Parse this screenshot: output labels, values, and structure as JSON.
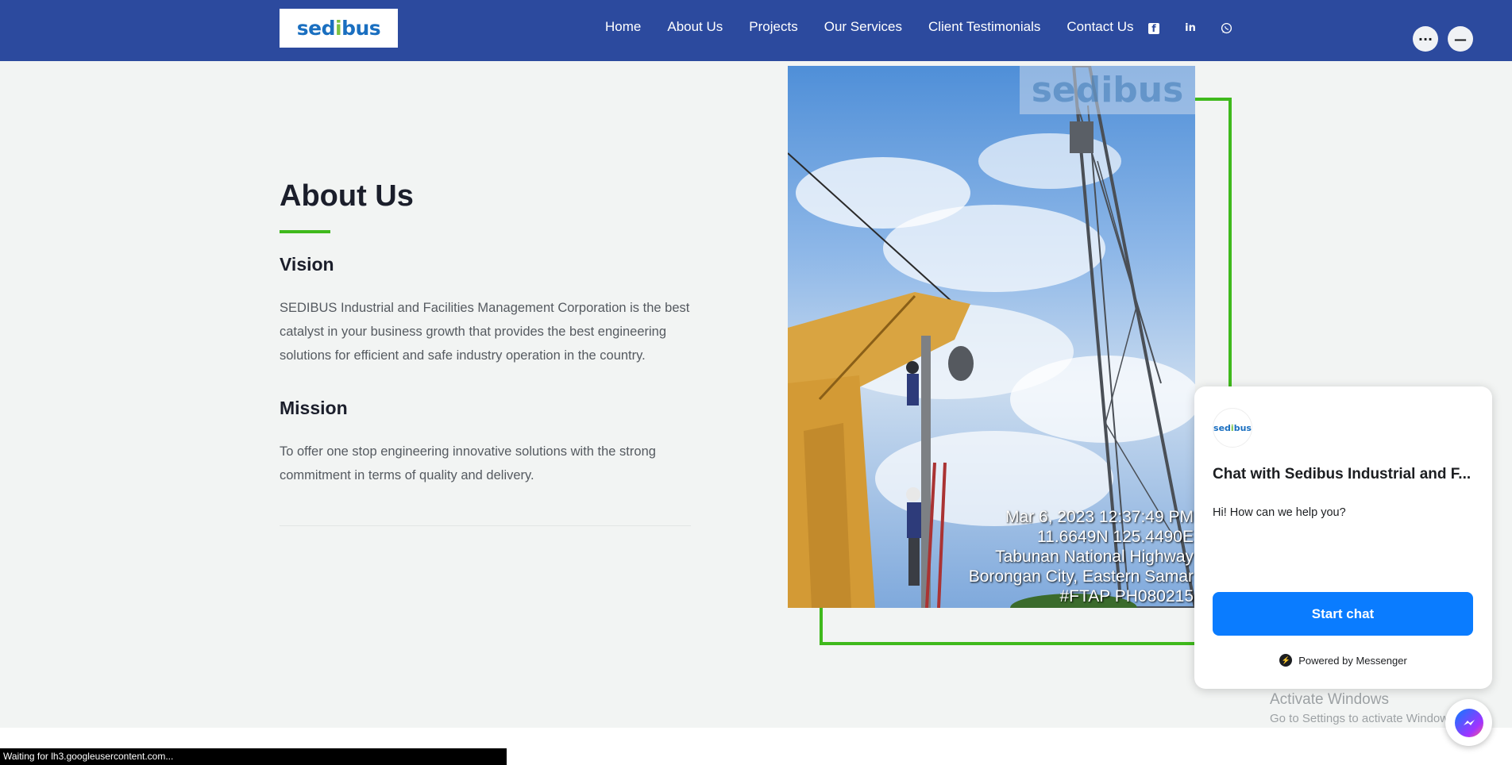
{
  "header": {
    "logo_alt": "sedibus",
    "nav": [
      "Home",
      "About Us",
      "Projects",
      "Our Services",
      "Client Testimonials",
      "Contact Us"
    ],
    "social_icons": [
      "facebook-icon",
      "linkedin-icon",
      "whatsapp-icon"
    ],
    "bg_color": "#2c4a9e"
  },
  "about": {
    "title": "About Us",
    "vision_heading": "Vision",
    "vision_text": "SEDIBUS Industrial and Facilities Management Corporation is the best catalyst in your business growth that provides the best engineering solutions for efficient and safe industry operation in the country.",
    "mission_heading": "Mission",
    "mission_text": "To offer one stop engineering innovative solutions with the strong commitment in terms of quality and delivery.",
    "accent_color": "#3fb91c"
  },
  "photo": {
    "watermark": "sedibus",
    "stamp_lines": [
      "Mar 6, 2023 12:37:49 PM",
      "11.6649N 125.4490E",
      "Tabunan National Highway",
      "Borongan City, Eastern Samar",
      "#FTAP PH080215"
    ]
  },
  "chat": {
    "avatar_text": "sedibus",
    "title": "Chat with Sedibus Industrial and F...",
    "message": "Hi! How can we help you?",
    "start_label": "Start chat",
    "powered_by": "Powered by Messenger",
    "accent_color": "#0a7cff"
  },
  "windows_notice": {
    "line1": "Activate Windows",
    "line2": "Go to Settings to activate Windows."
  },
  "status_bar": "Waiting for lh3.googleusercontent.com..."
}
